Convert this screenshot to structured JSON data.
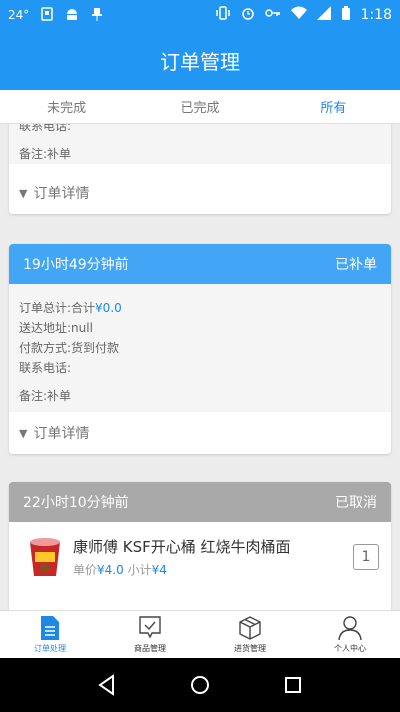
{
  "status_bar": {
    "temperature": "24°",
    "time": "1:18"
  },
  "app_bar": {
    "title": "订单管理"
  },
  "tabs": [
    {
      "label": "未完成",
      "active": false
    },
    {
      "label": "已完成",
      "active": false
    },
    {
      "label": "所有",
      "active": true
    }
  ],
  "partial_card": {
    "phone_label": "联系电话:",
    "note": "备注:补单",
    "detail_label": "订单详情"
  },
  "order_card_1": {
    "time_ago": "19小时49分钟前",
    "status": "已补单",
    "total_label": "订单总计:合计",
    "total_value": "¥0.0",
    "address": "送达地址:null",
    "payment": "付款方式:货到付款",
    "phone_label": "联系电话:",
    "note": "备注:补单",
    "detail_label": "订单详情"
  },
  "order_card_2": {
    "time_ago": "22小时10分钟前",
    "status": "已取消",
    "item": {
      "name": "康师傅 KSF开心桶 红烧牛肉桶面",
      "unit_price_label": "单价",
      "unit_price": "¥4.0",
      "subtotal_label": "小计",
      "subtotal": "¥4",
      "quantity": "1"
    }
  },
  "bottom_nav": [
    {
      "label": "订单处理",
      "icon": "document-icon",
      "active": true
    },
    {
      "label": "商品管理",
      "icon": "tag-check-icon",
      "active": false
    },
    {
      "label": "进货管理",
      "icon": "box-icon",
      "active": false
    },
    {
      "label": "个人中心",
      "icon": "person-icon",
      "active": false
    }
  ],
  "colors": {
    "primary": "#2196F3",
    "header_blue": "#42a5f5",
    "header_gray": "#a9a9a9",
    "accent_text": "#1e88e5"
  }
}
